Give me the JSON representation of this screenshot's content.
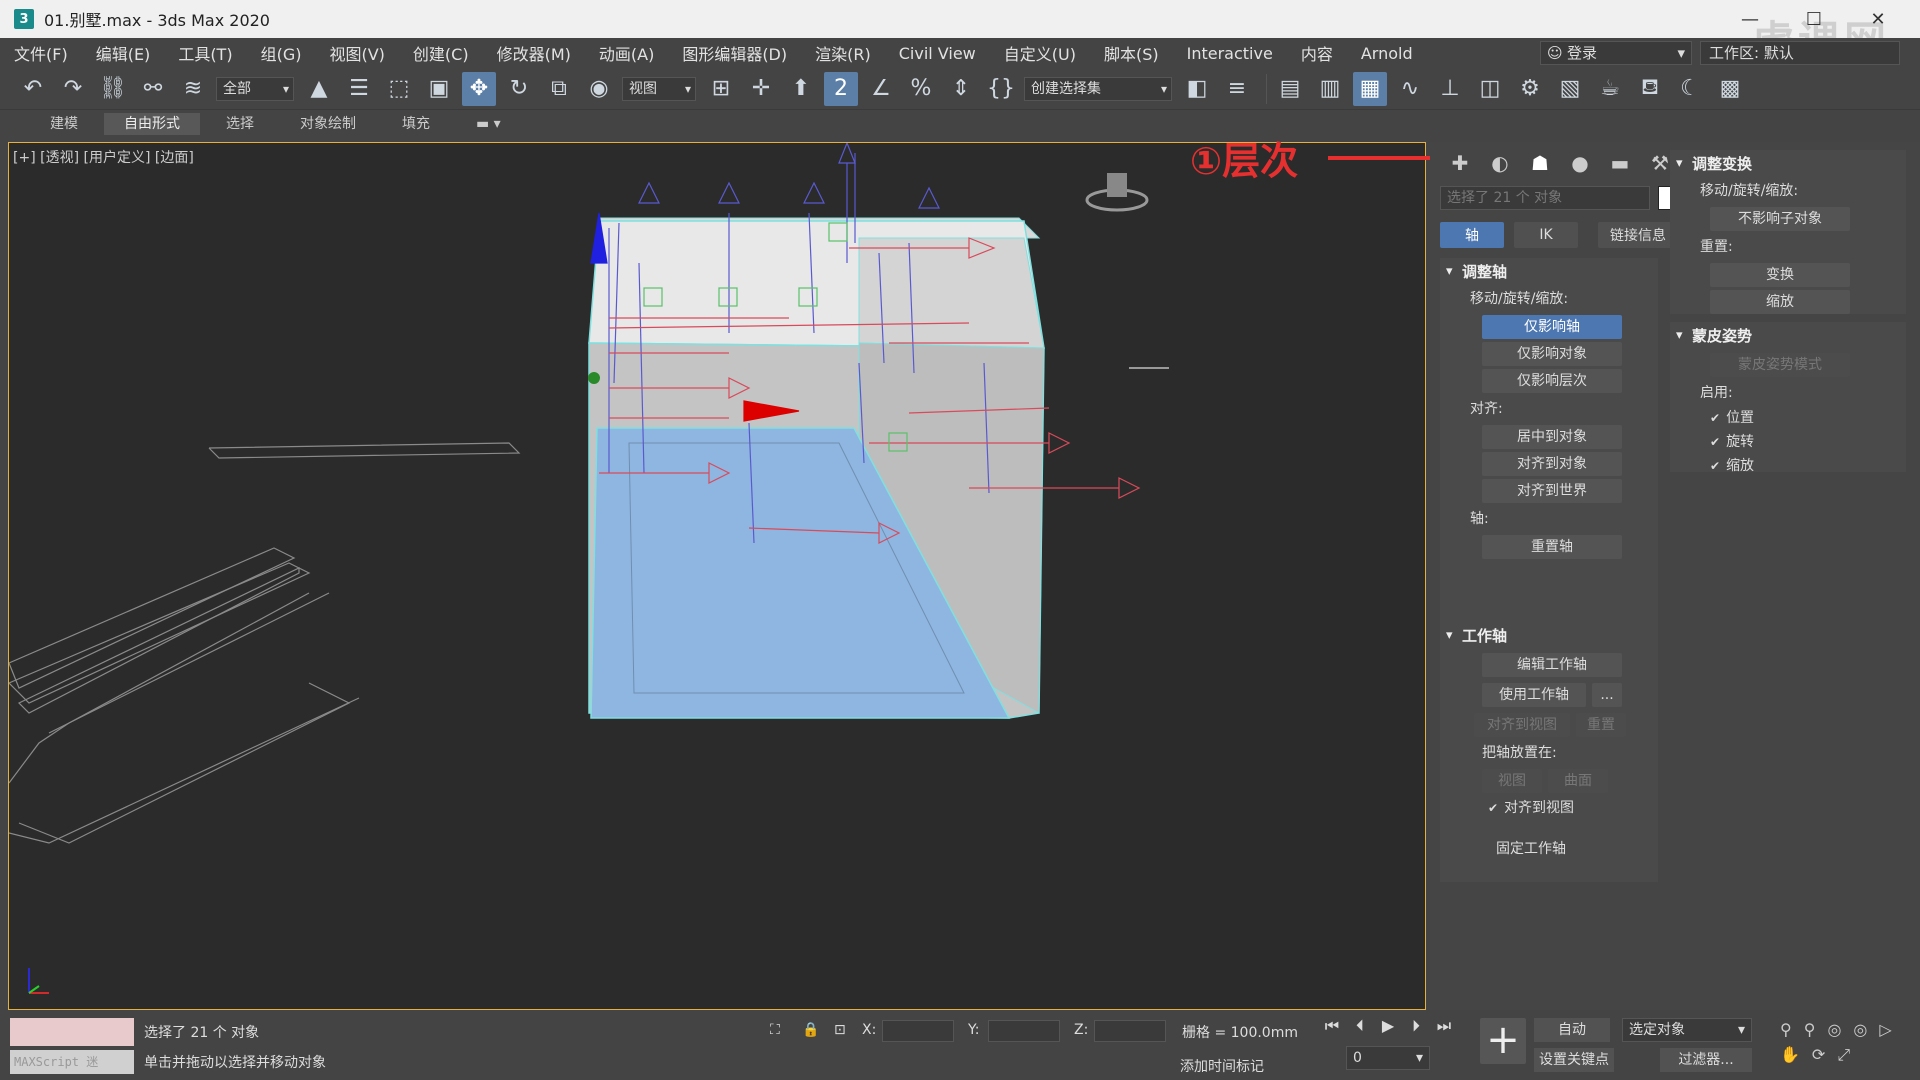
{
  "window": {
    "title": "01.别墅.max - 3ds Max 2020",
    "app_icon_glyph": "3",
    "minimize": "—",
    "maximize": "☐",
    "close": "✕",
    "watermark": "虎课网"
  },
  "menubar": {
    "items": [
      "文件(F)",
      "编辑(E)",
      "工具(T)",
      "组(G)",
      "视图(V)",
      "创建(C)",
      "修改器(M)",
      "动画(A)",
      "图形编辑器(D)",
      "渲染(R)",
      "Civil View",
      "自定义(U)",
      "脚本(S)",
      "Interactive",
      "内容",
      "Arnold"
    ],
    "login": "登录",
    "workspace": "工作区: 默认"
  },
  "toolbar": {
    "filter_dropdown": "全部",
    "refcoord_dropdown": "视图",
    "selection_set_dropdown": "创建选择集"
  },
  "ribbon": {
    "tabs": [
      "建模",
      "自由形式",
      "选择",
      "对象绘制",
      "填充"
    ],
    "active_tab": 1
  },
  "viewport": {
    "label": "[+] [透视] [用户定义] [边面]"
  },
  "annotation": {
    "text": "①层次"
  },
  "command_panel": {
    "object_field": "选择了 21 个 对象",
    "subtabs": [
      "轴",
      "IK",
      "链接信息"
    ],
    "adjust_pivot": {
      "title": "调整轴",
      "move_rotate_scale_label": "移动/旋转/缩放:",
      "btn_affect_pivot_only": "仅影响轴",
      "btn_affect_object_only": "仅影响对象",
      "btn_affect_hierarchy_only": "仅影响层次",
      "alignment_label": "对齐:",
      "btn_center_to_object": "居中到对象",
      "btn_align_to_object": "对齐到对象",
      "btn_align_to_world": "对齐到世界",
      "pivot_label": "轴:",
      "btn_reset_pivot": "重置轴"
    },
    "working_pivot": {
      "title": "工作轴",
      "btn_edit_working_pivot": "编辑工作轴",
      "btn_use_working_pivot": "使用工作轴",
      "btn_use_more": "...",
      "btn_align_to_view": "对齐到视图",
      "btn_reset": "重置",
      "place_pivot_label": "把轴放置在:",
      "btn_view": "视图",
      "btn_surface": "曲面",
      "check_align_to_view": "对齐到视图",
      "fixed_working_pivot": "固定工作轴"
    },
    "adjust_transform": {
      "title": "调整变换",
      "move_rotate_scale_label": "移动/旋转/缩放:",
      "btn_dont_affect_children": "不影响子对象",
      "reset_label": "重置:",
      "btn_transform": "变换",
      "btn_scale": "缩放"
    },
    "skin_pose": {
      "title": "蒙皮姿势",
      "btn_skin_pose_mode": "蒙皮姿势模式",
      "enabled_label": "启用:",
      "check_position": "位置",
      "check_rotation": "旋转",
      "check_scale": "缩放"
    }
  },
  "statusbar": {
    "maxscript_label": "MAXScript 迷",
    "selection_status": "选择了 21 个 对象",
    "prompt": "单击并拖动以选择并移动对象",
    "x_label": "X:",
    "y_label": "Y:",
    "z_label": "Z:",
    "grid": "栅格 = 100.0mm",
    "add_time_tag": "添加时间标记",
    "auto_key": "自动",
    "selected_objects_dropdown": "选定对象",
    "set_key": "设置关键点",
    "filters": "过滤器...",
    "frame": "0"
  },
  "colors": {
    "viewport_border": "#e4b23c",
    "active_button": "#4d77b0",
    "annotation_red": "#e63030"
  }
}
